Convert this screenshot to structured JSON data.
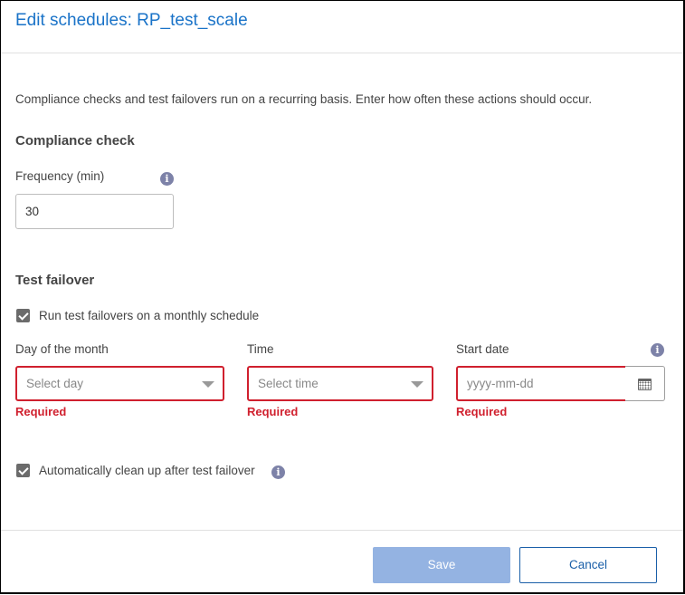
{
  "dialog": {
    "title": "Edit schedules: RP_test_scale",
    "description": "Compliance checks and test failovers run on a recurring basis. Enter how often these actions should occur."
  },
  "compliance": {
    "section_title": "Compliance check",
    "frequency_label": "Frequency (min)",
    "frequency_value": "30",
    "info_icon": "info-icon"
  },
  "failover": {
    "section_title": "Test failover",
    "monthly_checkbox": {
      "label": "Run test failovers on a monthly schedule",
      "checked": true
    },
    "day": {
      "label": "Day of the month",
      "placeholder": "Select day",
      "error": "Required"
    },
    "time": {
      "label": "Time",
      "placeholder": "Select time",
      "error": "Required"
    },
    "start_date": {
      "label": "Start date",
      "placeholder": "yyyy-mm-dd",
      "error": "Required",
      "calendar_icon": "calendar-icon",
      "info_icon": "info-icon"
    },
    "cleanup_checkbox": {
      "label": "Automatically clean up after test failover",
      "checked": true,
      "info_icon": "info-icon"
    }
  },
  "footer": {
    "save_label": "Save",
    "cancel_label": "Cancel"
  },
  "colors": {
    "title": "#1a73c8",
    "error": "#d0202e",
    "save_disabled": "#94b3e2",
    "cancel_text": "#1a5fa8",
    "info_icon": "#7d82a8"
  }
}
